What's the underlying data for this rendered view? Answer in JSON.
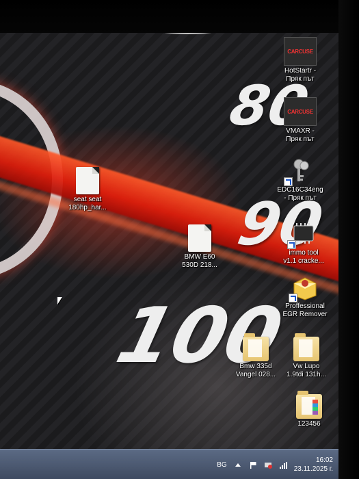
{
  "desktop": {
    "wallpaper_numbers": [
      "80",
      "90",
      "100"
    ],
    "icons": [
      {
        "label": "seat seat\n180hp_har...",
        "line1": "seat seat",
        "line2": "180hp_har...",
        "icon": "document-icon"
      },
      {
        "label": "BMW E60 530D 218...",
        "line1": "BMW E60",
        "line2": "530D 218...",
        "icon": "document-icon"
      },
      {
        "label": "HotStartr - Пряк път",
        "line1": "HotStartr -",
        "line2": "Пряк път",
        "icon": "carcuse-logo-icon"
      },
      {
        "label": "VMAXR - Пряк път",
        "line1": "VMAXR -",
        "line2": "Пряк път",
        "icon": "carcuse-logo-icon"
      },
      {
        "label": "EDC16C34eng - Пряк път",
        "line1": "EDC16C34eng",
        "line2": "- Пряк път",
        "icon": "keys-icon"
      },
      {
        "label": "immo tool v1.1 cracke...",
        "line1": "immo tool",
        "line2": "v1.1 cracke...",
        "icon": "chip-icon"
      },
      {
        "label": "Proffessional EGR Remover",
        "line1": "Proffessional",
        "line2": "EGR Remover",
        "icon": "egr-box-icon"
      },
      {
        "label": "Bmw 335d Vangel 028...",
        "line1": "Bmw 335d",
        "line2": "Vangel 028...",
        "icon": "folder-icon"
      },
      {
        "label": "Vw Lupo 1.9tdi 131h...",
        "line1": "Vw Lupo",
        "line2": "1.9tdi 131h...",
        "icon": "folder-icon"
      },
      {
        "label": "123456",
        "line1": "123456",
        "line2": "",
        "icon": "folder-icon"
      }
    ],
    "logo_text": "CARCUSE"
  },
  "taskbar": {
    "language": "BG",
    "time": "16:02",
    "date": "23.11.2025 г."
  }
}
